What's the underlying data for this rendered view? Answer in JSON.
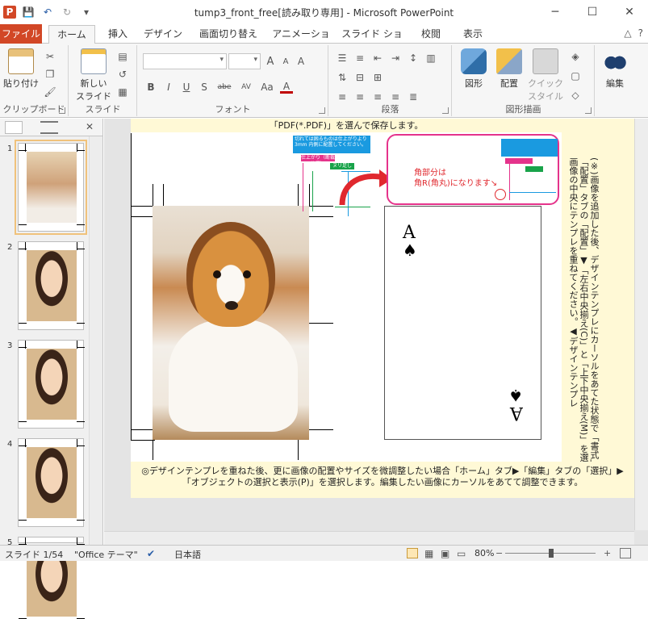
{
  "window": {
    "title": "tump3_front_free[読み取り専用] - Microsoft PowerPoint",
    "app_icon_letter": "P",
    "minimize": "─",
    "maximize": "☐",
    "close": "✕"
  },
  "qat": {
    "save": "💾",
    "undo": "↶",
    "redo": "↻",
    "customize": "▾"
  },
  "tabs": [
    "ファイル",
    "ホーム",
    "挿入",
    "デザイン",
    "画面切り替え",
    "アニメーション",
    "スライド ショー",
    "校閲",
    "表示"
  ],
  "ribbon_right": {
    "minimize": "△",
    "help": "?"
  },
  "ribbon": {
    "groups": {
      "clipboard": "クリップボード",
      "slides": "スライド",
      "font": "フォント",
      "paragraph": "段落",
      "drawing": "図形描画",
      "editing": ""
    },
    "buttons": {
      "paste": "貼り付け",
      "new_slide_line1": "新しい",
      "new_slide_line2": "スライド",
      "shapes": "図形",
      "arrange": "配置",
      "quick_styles_line1": "クイック",
      "quick_styles_line2": "スタイル",
      "editing": "編集"
    },
    "font_buttons": [
      "B",
      "I",
      "U",
      "S",
      "abe",
      "AV",
      "Aa",
      "A"
    ],
    "font_size_buttons": [
      "A",
      "A",
      "A"
    ]
  },
  "thumbnails": [
    {
      "number": "1",
      "kind": "dog",
      "selected": true
    },
    {
      "number": "2",
      "kind": "child",
      "selected": false
    },
    {
      "number": "3",
      "kind": "child",
      "selected": false
    },
    {
      "number": "4",
      "kind": "child",
      "selected": false
    },
    {
      "number": "5",
      "kind": "child",
      "selected": false
    }
  ],
  "slide": {
    "note_top": "「PDF(*.PDF)」を選んで保存します。",
    "note_right": "(※)画像を追加した後、デザインテンプレにカーソルをあてた状態で「書式」タブ▶「配置」タブの「配置」▼「左右中央揃え(C)」と「上下中央揃え(M)」を選択し、画像の中央にテンプレを重ねてください。◀デザインテンプレ",
    "note_bottom": "◎デザインテンプレを重ねた後、更に画像の配置やサイズを微調整したい場合「ホーム」タブ▶「編集」タブの「選択」▶「オブジェクトの選択と表示(P)」を選択します。編集したい画像にカーソルをあてて調整できます。",
    "mini_callout_head": "切れては困るものは仕上がりより3mm 内側に配置してください。",
    "mini_tag_finish": "仕上がり（断裁位置）",
    "mini_tag_bleed": "ヌリ足し",
    "corner_note": "角部分は\n角R(角丸)になります↘",
    "card_rank": "A",
    "card_suit": "♠"
  },
  "status": {
    "slide_count": "スライド 1/54",
    "theme": "\"Office テーマ\"",
    "language": "日本語",
    "zoom": "80%"
  }
}
